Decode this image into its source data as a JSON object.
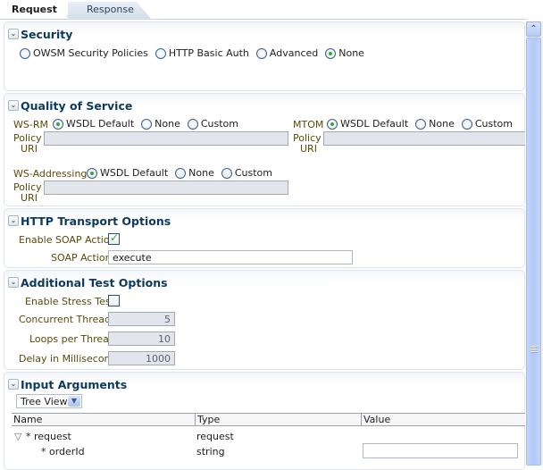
{
  "tabs": [
    {
      "label": "Request",
      "active": true
    },
    {
      "label": "Response",
      "active": false
    }
  ],
  "security": {
    "title": "Security",
    "options": [
      {
        "label": "OWSM Security Policies",
        "selected": false
      },
      {
        "label": "HTTP Basic Auth",
        "selected": false
      },
      {
        "label": "Advanced",
        "selected": false
      },
      {
        "label": "None",
        "selected": true
      }
    ]
  },
  "qos": {
    "title": "Quality of Service",
    "wsrm": {
      "label": "WS-RM",
      "options": [
        {
          "label": "WSDL Default",
          "selected": true
        },
        {
          "label": "None",
          "selected": false
        },
        {
          "label": "Custom",
          "selected": false
        }
      ],
      "policy_label_1": "Policy",
      "policy_label_2": "URI",
      "policy_value": ""
    },
    "mtom": {
      "label": "MTOM",
      "options": [
        {
          "label": "WSDL Default",
          "selected": true
        },
        {
          "label": "None",
          "selected": false
        },
        {
          "label": "Custom",
          "selected": false
        }
      ],
      "policy_label_1": "Policy",
      "policy_label_2": "URI",
      "policy_value": ""
    },
    "wsaddressing": {
      "label": "WS-Addressing",
      "options": [
        {
          "label": "WSDL Default",
          "selected": true
        },
        {
          "label": "None",
          "selected": false
        },
        {
          "label": "Custom",
          "selected": false
        }
      ],
      "policy_label_1": "Policy",
      "policy_label_2": "URI",
      "policy_value": ""
    }
  },
  "http": {
    "title": "HTTP Transport Options",
    "enable_soap_label": "Enable SOAP Action",
    "enable_soap_checked": true,
    "soap_action_label": "SOAP Action",
    "soap_action_value": "execute"
  },
  "additional": {
    "title": "Additional Test Options",
    "stress_label": "Enable Stress Test",
    "stress_checked": false,
    "threads_label": "Concurrent Threads",
    "threads_value": "5",
    "loops_label": "Loops per Thread",
    "loops_value": "10",
    "delay_label": "Delay in Milliseconds",
    "delay_value": "1000"
  },
  "input": {
    "title": "Input Arguments",
    "view_select": "Tree View",
    "columns": [
      "Name",
      "Type",
      "Value"
    ],
    "rows": [
      {
        "name": "* request",
        "type": "request",
        "expandable": true,
        "value": null
      },
      {
        "name": "* orderId",
        "type": "string",
        "expandable": false,
        "value": ""
      }
    ]
  },
  "icons": {
    "disclose": "chevron-down-icon",
    "expand": "triangle-down-icon",
    "scroll_up": "chevron-up-icon",
    "select": "chevron-down-icon",
    "check": "checkmark-icon"
  }
}
